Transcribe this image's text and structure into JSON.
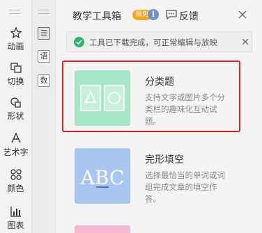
{
  "rail": {
    "items": [
      {
        "label": "动画",
        "icon": "animation-star-icon"
      },
      {
        "label": "切换",
        "icon": "transition-icon"
      },
      {
        "label": "形状",
        "icon": "shape-icon"
      },
      {
        "label": "艺术字",
        "icon": "art-text-icon"
      },
      {
        "label": "颜色",
        "icon": "color-grid-icon"
      },
      {
        "label": "图表",
        "icon": "chart-icon"
      }
    ]
  },
  "categories": {
    "items": [
      {
        "glyph": "☰",
        "name": "list"
      },
      {
        "glyph": "语",
        "name": "language"
      },
      {
        "glyph": "数",
        "name": "math"
      }
    ]
  },
  "panel": {
    "title": "教学工具箱",
    "badge": "限免",
    "feedback_label": "反馈",
    "notice": "工具已下载完成，可正常编辑与放映",
    "cards": [
      {
        "title": "分类题",
        "desc": "支持文字或图片多个分类栏的趣味化互动试题。",
        "thumb_color": "#a8e6c9"
      },
      {
        "title": "完形填空",
        "desc": "选择最恰当的单词或词组完成文章的填空作答。",
        "thumb_color": "#a9c6f2",
        "thumb_text": "ABC"
      }
    ]
  },
  "colors": {
    "accent_red": "#e02020",
    "badge": "#f5a623",
    "check": "#2fb36d"
  }
}
